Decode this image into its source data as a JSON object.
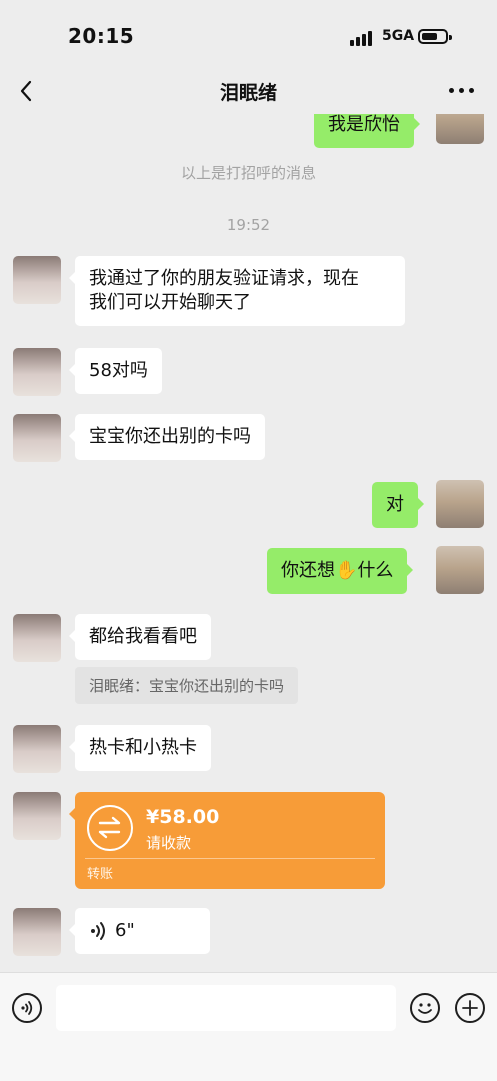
{
  "status": {
    "time": "20:15",
    "network": "5GA",
    "battery_level": 0.7
  },
  "nav": {
    "title": "泪眠绪"
  },
  "messages": {
    "m0": "我是欣怡",
    "system_note": "以上是打招呼的消息",
    "timestamp": "19:52",
    "m1_line1": "我通过了你的朋友验证请求，现在",
    "m1_line2": "我们可以开始聊天了",
    "m2": "58对吗",
    "m3": "宝宝你还出别的卡吗",
    "m4": "对",
    "m5_before": "你还想",
    "m5_emoji": "✋",
    "m5_after": "什么",
    "m6": "都给我看看吧",
    "m6_quote": "泪眠绪：宝宝你还出别的卡吗",
    "m7": "热卡和小热卡",
    "voice_duration": "6\""
  },
  "transfer": {
    "amount": "¥58.00",
    "status": "请收款",
    "label": "转账"
  },
  "colors": {
    "outgoing": "#95ec69",
    "transfer": "#f79c38",
    "background": "#ededed"
  },
  "icons": [
    "back-icon",
    "more-icon",
    "voice-mode-icon",
    "emoji-icon",
    "plus-icon",
    "transfer-icon",
    "voice-wave-icon"
  ]
}
